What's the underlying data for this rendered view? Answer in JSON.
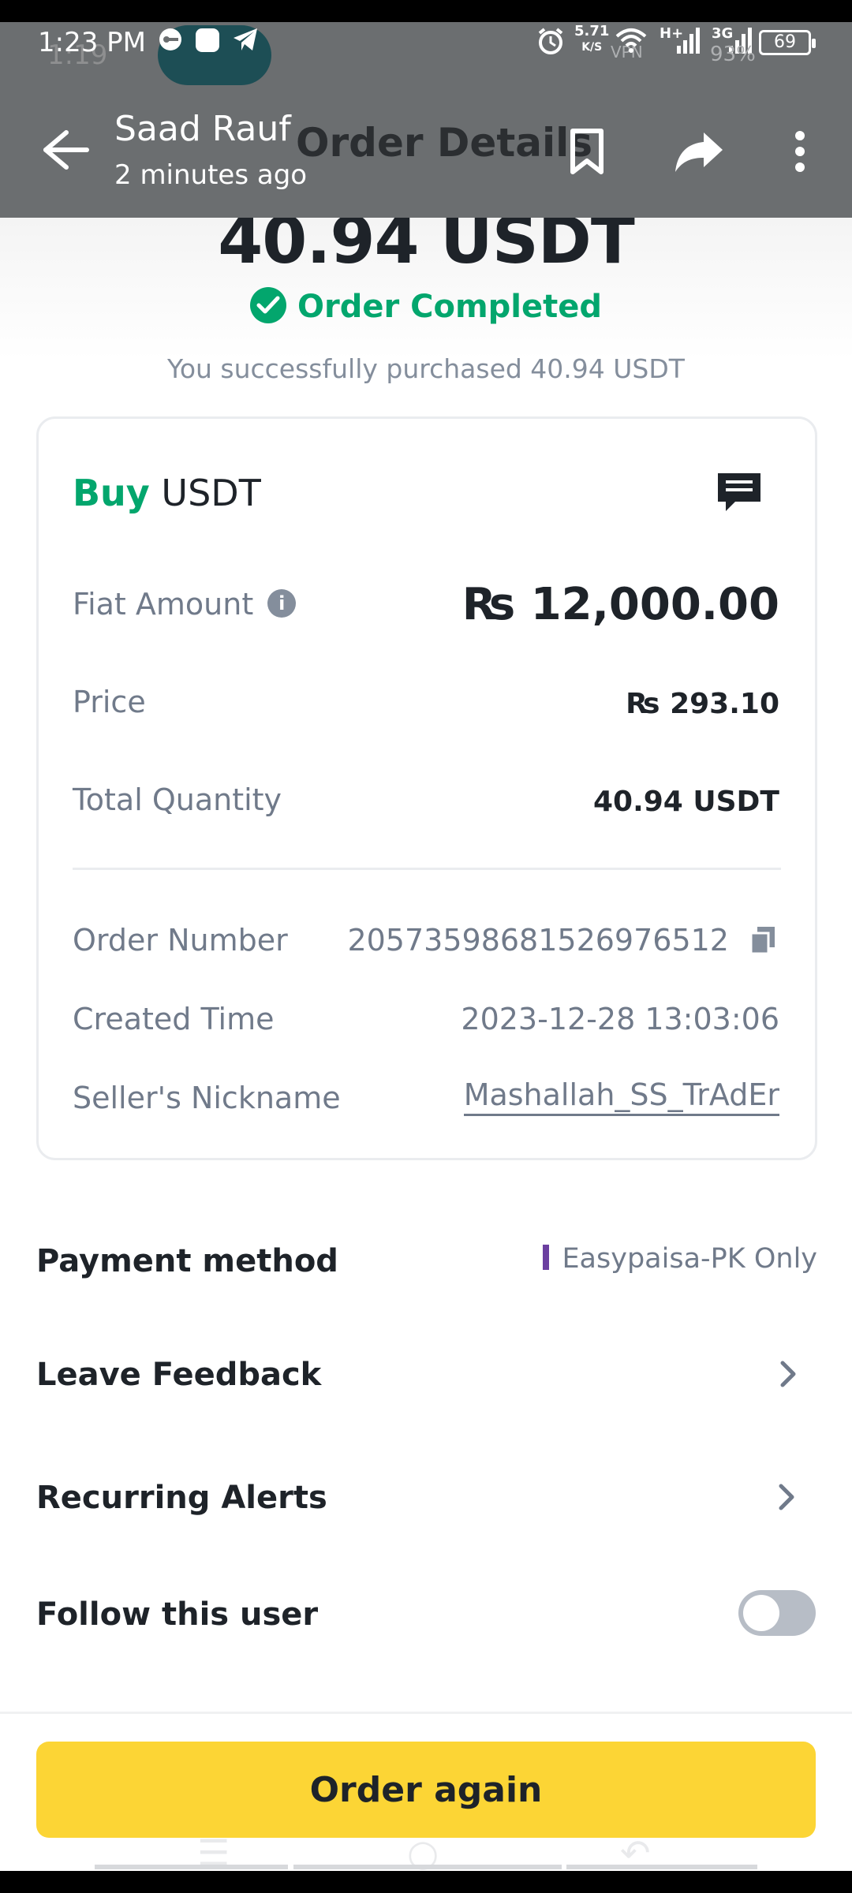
{
  "status_bar": {
    "time": "1:23 PM",
    "faded_time": "1:19",
    "net_speed": "5.71",
    "net_unit": "K/S",
    "net_type_1": "H+",
    "net_type_2": "3G",
    "battery": "69",
    "faded_battery": "93%",
    "vpn": "VPN"
  },
  "viewer": {
    "sender": "Saad Rauf",
    "sent_time": "2 minutes ago"
  },
  "page": {
    "title": "Order Details",
    "amount": "40.94 USDT",
    "status": "Order Completed",
    "subtitle": "You successfully purchased  40.94 USDT"
  },
  "card": {
    "side": "Buy",
    "asset": "USDT",
    "fiat_amount_label": "Fiat Amount",
    "fiat_amount": "₨ 12,000.00",
    "price_label": "Price",
    "price": "₨ 293.10",
    "total_quantity_label": "Total Quantity",
    "total_quantity": "40.94 USDT",
    "order_number_label": "Order Number",
    "order_number": "20573598681526976512",
    "created_time_label": "Created Time",
    "created_time": "2023-12-28 13:03:06",
    "seller_label": "Seller's Nickname",
    "seller": "Mashallah_SS_TrAdEr"
  },
  "options": {
    "payment_method_label": "Payment method",
    "payment_method": "Easypaisa-PK Only",
    "payment_color": "#6b3fa0",
    "leave_feedback": "Leave Feedback",
    "recurring_alerts": "Recurring Alerts",
    "follow_user": "Follow this user",
    "follow_enabled": false
  },
  "actions": {
    "order_again": "Order again"
  },
  "colors": {
    "accent_green": "#03a66d",
    "button_yellow": "#fcd535",
    "overlay_grey": "#6b6e70"
  }
}
